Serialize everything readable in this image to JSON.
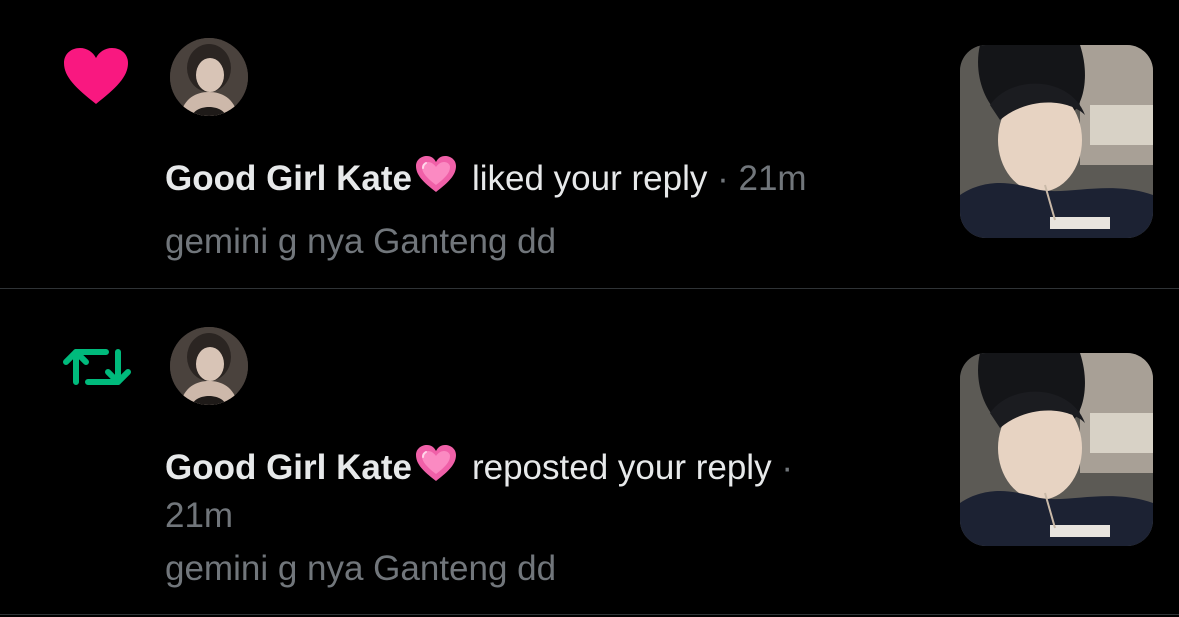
{
  "colors": {
    "like_accent": "#f91880",
    "repost_accent": "#00ba7c",
    "text_primary": "#e7e9ea",
    "text_secondary": "#71767b",
    "divider": "#2f3336",
    "background": "#000000"
  },
  "notifications": [
    {
      "type": "like",
      "type_icon": "heart-icon",
      "actor_name": "Good Girl Kate",
      "actor_emoji": "pink-heart-emoji",
      "action": "liked your reply",
      "separator": "·",
      "time": "21m",
      "reply_text": "gemini g nya Ganteng dd"
    },
    {
      "type": "repost",
      "type_icon": "repost-icon",
      "actor_name": "Good Girl Kate",
      "actor_emoji": "pink-heart-emoji",
      "action": "reposted your reply",
      "separator": "·",
      "time": "21m",
      "reply_text": "gemini g nya Ganteng dd"
    }
  ]
}
